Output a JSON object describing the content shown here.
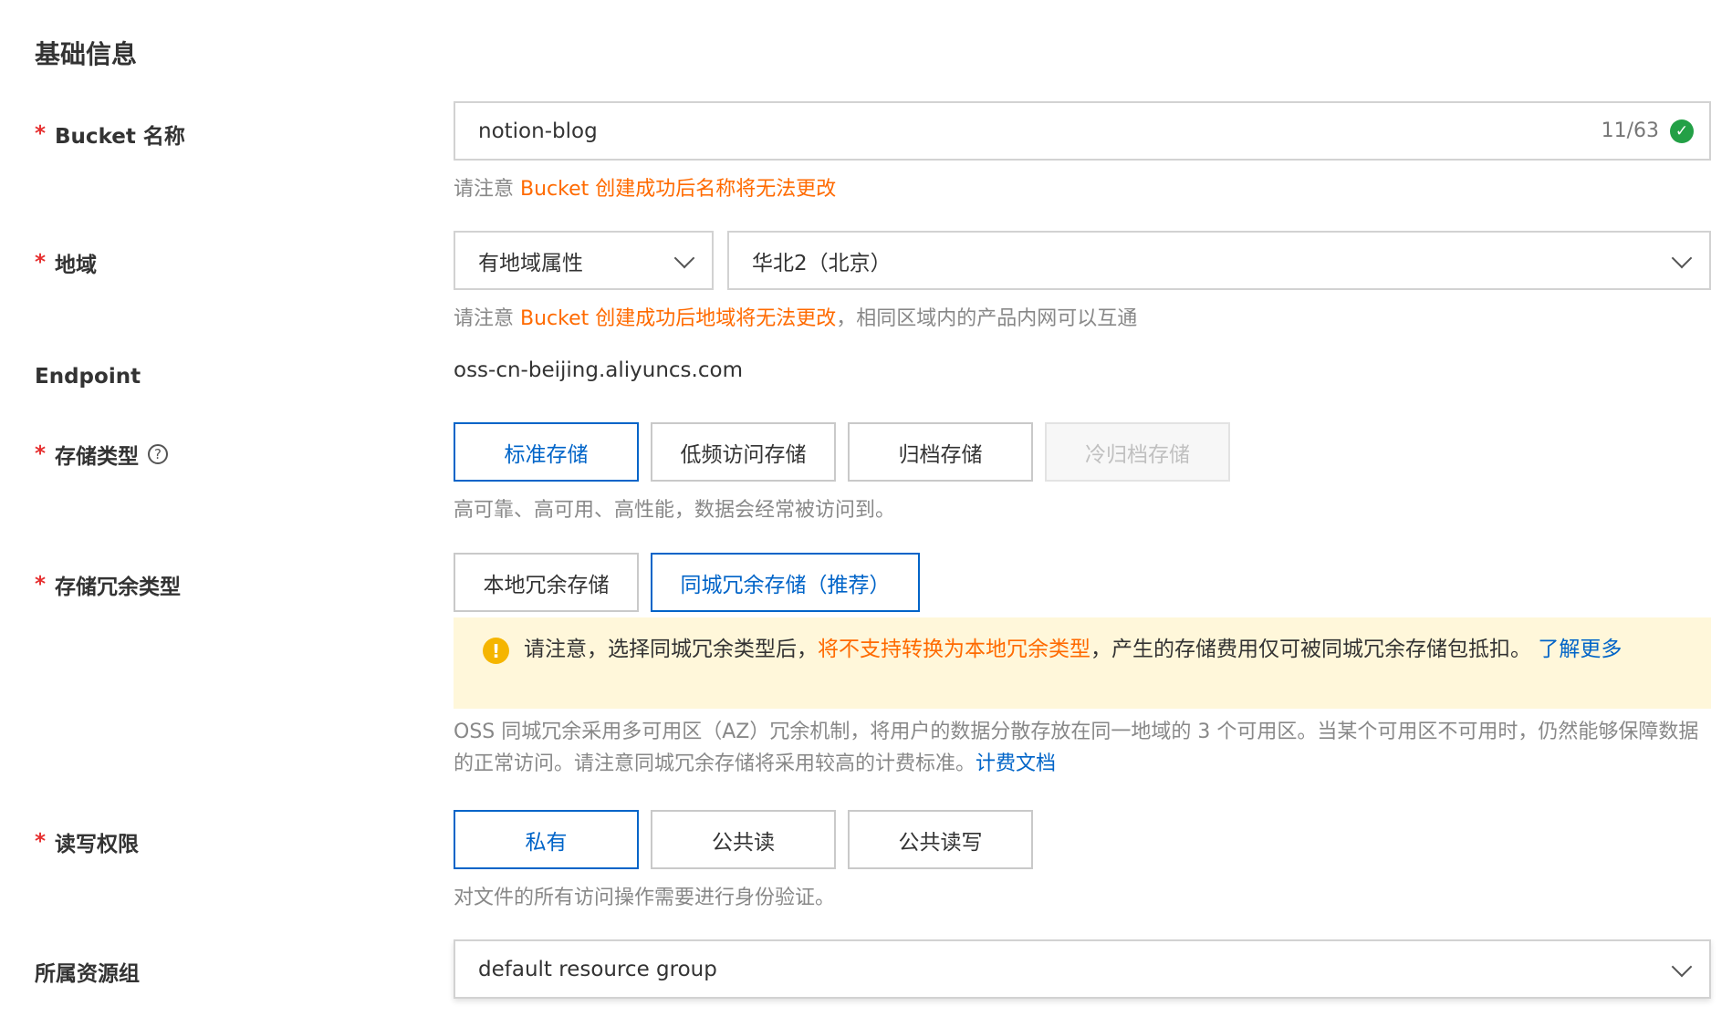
{
  "section_title": "基础信息",
  "required_mark": "*",
  "bucket_name": {
    "label": "Bucket 名称",
    "value": "notion-blog",
    "counter": "11/63",
    "hint_prefix": "请注意 ",
    "hint_warning": "Bucket 创建成功后名称将无法更改"
  },
  "region": {
    "label": "地域",
    "type_select": "有地域属性",
    "region_select": "华北2（北京）",
    "hint_prefix": "请注意 ",
    "hint_warning": "Bucket 创建成功后地域将无法更改",
    "hint_suffix": "，相同区域内的产品内网可以互通"
  },
  "endpoint": {
    "label": "Endpoint",
    "value": "oss-cn-beijing.aliyuncs.com"
  },
  "storage_class": {
    "label": "存储类型",
    "help_glyph": "?",
    "options": [
      "标准存储",
      "低频访问存储",
      "归档存储",
      "冷归档存储"
    ],
    "selected": "标准存储",
    "disabled": "冷归档存储",
    "hint": "高可靠、高可用、高性能，数据会经常被访问到。"
  },
  "redundancy": {
    "label": "存储冗余类型",
    "options": [
      "本地冗余存储",
      "同城冗余存储（推荐）"
    ],
    "selected": "同城冗余存储（推荐）",
    "alert_prefix": "请注意，选择同城冗余类型后，",
    "alert_warning": "将不支持转换为本地冗余类型",
    "alert_suffix": "，产生的存储费用仅可被同城冗余存储包抵扣。",
    "alert_link": "了解更多",
    "note": "OSS 同城冗余采用多可用区（AZ）冗余机制，将用户的数据分散存放在同一地域的 3 个可用区。当某个可用区不可用时，仍然能够保障数据的正常访问。请注意同城冗余存储将采用较高的计费标准。",
    "note_link": "计费文档"
  },
  "acl": {
    "label": "读写权限",
    "options": [
      "私有",
      "公共读",
      "公共读写"
    ],
    "selected": "私有",
    "hint": "对文件的所有访问操作需要进行身份验证。"
  },
  "resource_group": {
    "label": "所属资源组",
    "value": "default resource group"
  },
  "colors": {
    "primary": "#0064c8",
    "warning": "#ff6a00",
    "required": "#e62e2e",
    "success": "#23a046",
    "alert_bg": "#fff7da"
  },
  "icons": [
    "check-circle-icon",
    "chevron-down-icon",
    "help-circle-icon",
    "exclamation-circle-icon"
  ]
}
